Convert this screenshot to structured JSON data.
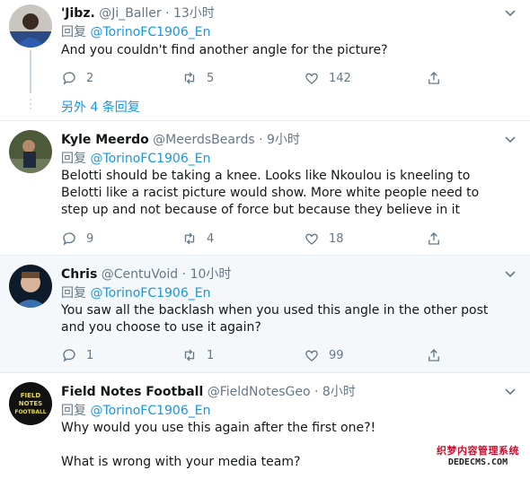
{
  "tweets": [
    {
      "name": "'Jibz.",
      "handle": "@Ji_Baller",
      "dot": "·",
      "time": "13小时",
      "reply_prefix": "回复",
      "reply_to": "@TorinoFC1906_En",
      "lines": [
        "And you couldn't find another angle for the picture?"
      ],
      "replies": "2",
      "retweets": "5",
      "likes": "142"
    },
    {
      "name": "Kyle Meerdo",
      "handle": "@MeerdsBeards",
      "dot": "·",
      "time": "9小时",
      "reply_prefix": "回复",
      "reply_to": "@TorinoFC1906_En",
      "lines": [
        "Belotti should be taking a knee. Looks like Nkoulou is kneeling to",
        "Belotti like a racist picture would show. More white people need to",
        "step up and not because of force but because they believe in it"
      ],
      "replies": "9",
      "retweets": "4",
      "likes": "18"
    },
    {
      "name": "Chris",
      "handle": "@CentuVoid",
      "dot": "·",
      "time": "10小时",
      "reply_prefix": "回复",
      "reply_to": "@TorinoFC1906_En",
      "lines": [
        "You saw all the backlash when you used this angle in the other post",
        "and you choose to use it again?"
      ],
      "replies": "1",
      "retweets": "1",
      "likes": "99"
    },
    {
      "name": "Field Notes Football",
      "handle": "@FieldNotesGeo",
      "dot": "·",
      "time": "8小时",
      "reply_prefix": "回复",
      "reply_to": "@TorinoFC1906_En",
      "lines": [
        "Why would you use this again after the first one?!",
        "",
        "What is wrong with your media team?"
      ]
    }
  ],
  "more_replies": "另外 4 条回复",
  "avatar_logo_lines": [
    "FIELD",
    "NOTES",
    "FOOTBALL"
  ],
  "watermark": {
    "line1": "织梦内容管理系统",
    "line2": "DEDECMS.COM"
  },
  "colors": {
    "link": "#1b95e0",
    "muted": "#657786",
    "highlight_bg": "#f5f8fa",
    "separator": "#e6ecf0"
  },
  "icons": [
    "chevron-down-icon",
    "reply-icon",
    "retweet-icon",
    "like-icon",
    "share-icon"
  ]
}
